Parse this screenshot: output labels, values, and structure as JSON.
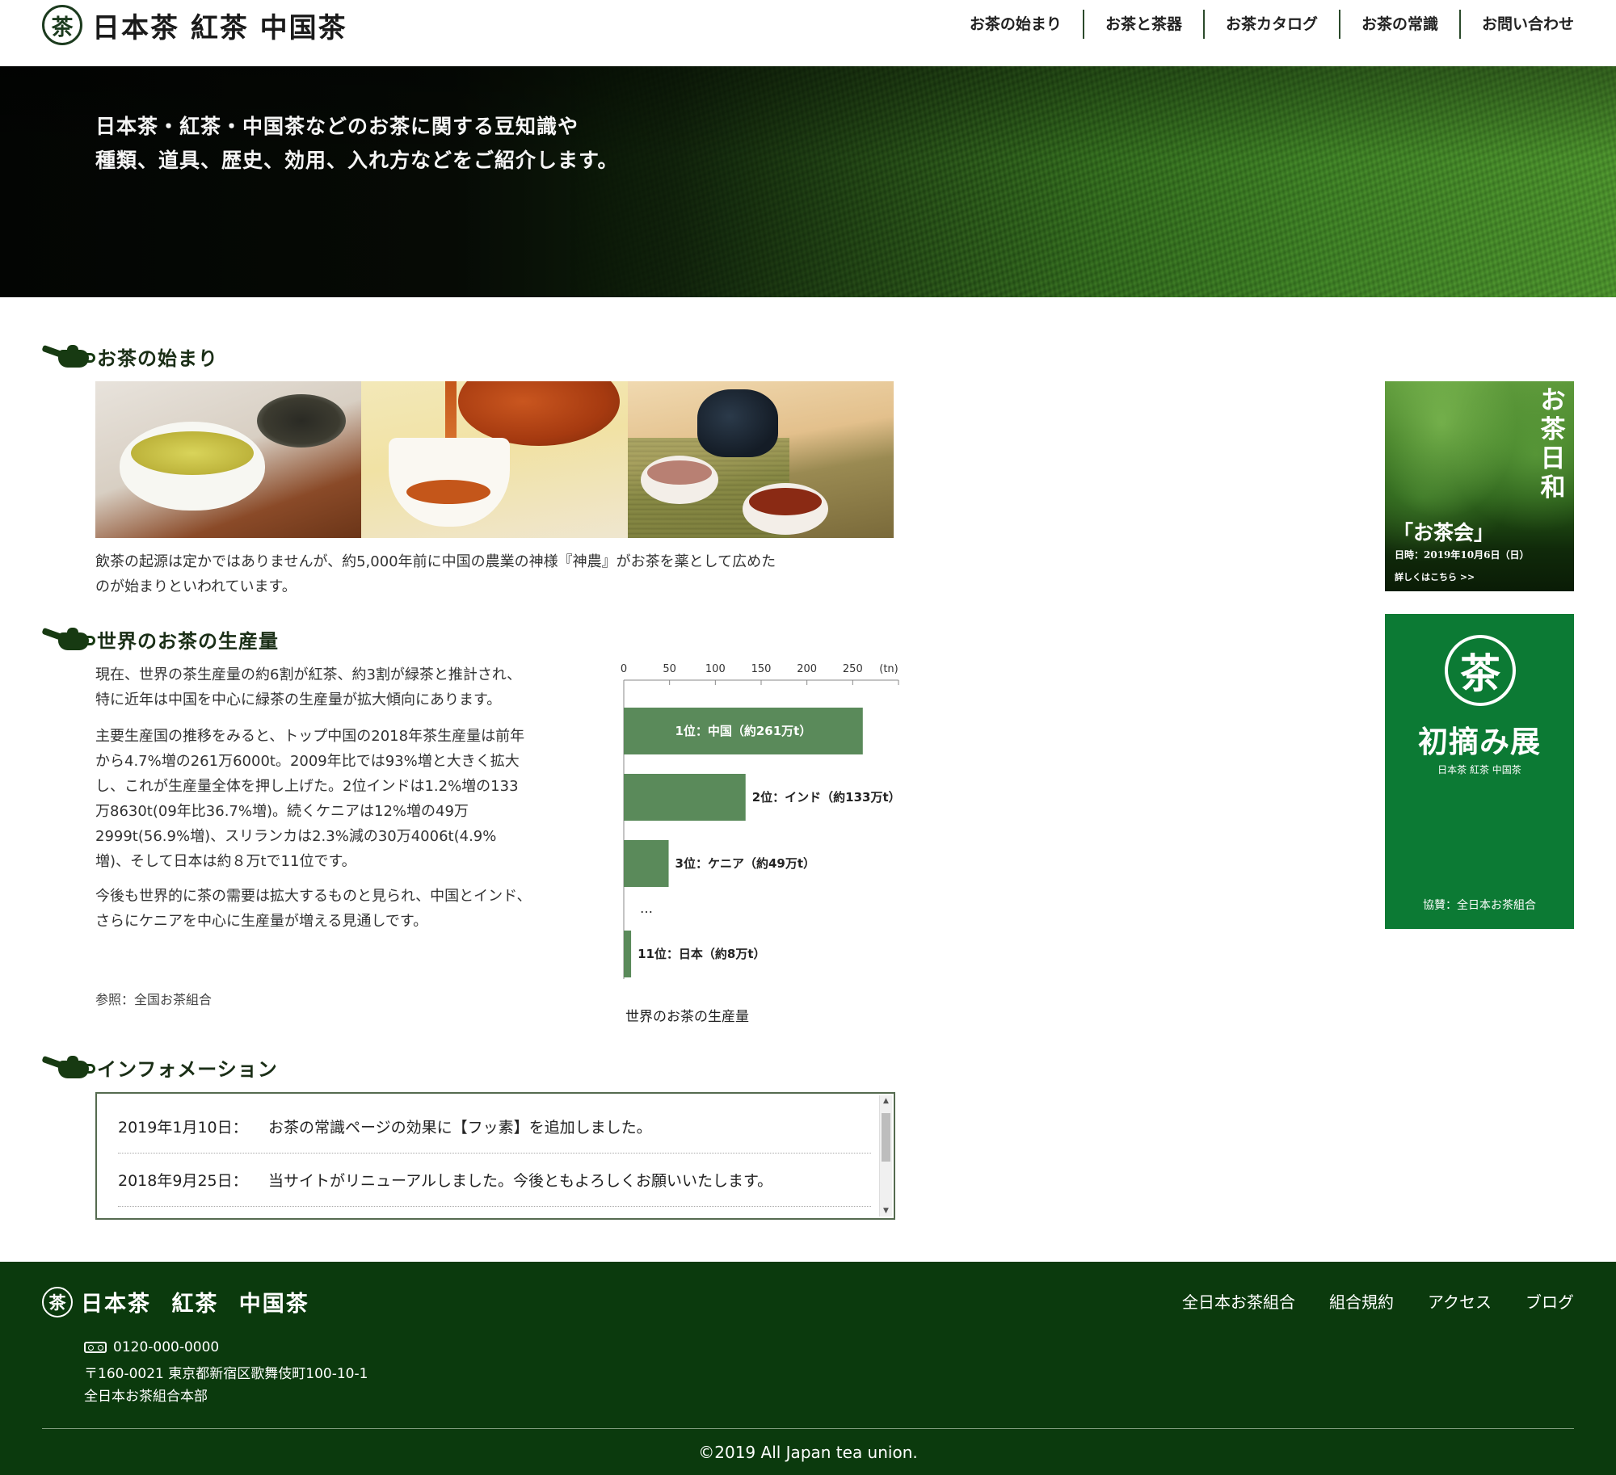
{
  "header": {
    "logo_mark": "茶",
    "logo_text": "日本茶 紅茶 中国茶",
    "nav": [
      "お茶の始まり",
      "お茶と茶器",
      "お茶カタログ",
      "お茶の常識",
      "お問い合わせ"
    ]
  },
  "hero": {
    "line1": "日本茶・紅茶・中国茶などのお茶に関する豆知識や",
    "line2": "種類、道具、歴史、効用、入れ方などをご紹介します。"
  },
  "origin": {
    "title": "お茶の始まり",
    "line1": "飲茶の起源は定かではありませんが、約5,000年前に中国の農業の神様『神農』がお茶を薬として広めた",
    "line2": "のが始まりといわれています。"
  },
  "production": {
    "title": "世界のお茶の生産量",
    "p1_line1": "現在、世界の茶生産量の約6割が紅茶、約3割が緑茶と推計され、",
    "p1_line2": "特に近年は中国を中心に緑茶の生産量が拡大傾向にあります。",
    "p2_line1": "主要生産国の推移をみると、トップ中国の2018年茶生産量は前年",
    "p2_line2": "から4.7%増の261万6000t。2009年比では93%増と大きく拡大",
    "p2_line3": "し、これが生産量全体を押し上げた。2位インドは1.2%増の133",
    "p2_line4": "万8630t(09年比36.7%増)。続くケニアは12%増の49万",
    "p2_line5": "2999t(56.9%増)、スリランカは2.3%減の30万4006t(4.9%",
    "p2_line6": "増)、そして日本は約８万tで11位です。",
    "p3_line1": "今後も世界的に茶の需要は拡大するものと見られ、中国とインド、",
    "p3_line2": "さらにケニアを中心に生産量が増える見通しです。",
    "reference": "参照：全国お茶組合"
  },
  "chart_data": {
    "type": "bar",
    "orientation": "horizontal",
    "title": "",
    "caption": "世界のお茶の生産量",
    "xlabel": "",
    "unit_label": "(tn)",
    "xlim": [
      0,
      300
    ],
    "ticks": [
      "0",
      "50",
      "100",
      "150",
      "200",
      "250"
    ],
    "tick_values": [
      0,
      50,
      100,
      150,
      200,
      250
    ],
    "categories": [
      "1位：中国（約261万t）",
      "2位：インド（約133万t）",
      "3位：ケニア（約49万t）",
      "11位：日本（約8万t）"
    ],
    "values": [
      261,
      133,
      49,
      8
    ],
    "ellipsis": "…",
    "bar_color": "#5a8a5a",
    "label_inside": [
      true,
      false,
      false,
      false
    ],
    "grid": false
  },
  "info": {
    "title": "インフォメーション",
    "items": [
      {
        "date": "2019年1月10日：",
        "text": "お茶の常識ページの効果に【フッ素】を追加しました。"
      },
      {
        "date": "2018年9月25日：",
        "text": "当サイトがリニューアルしました。今後ともよろしくお願いいたします。"
      }
    ]
  },
  "banner1": {
    "vertical_title": "お茶日和",
    "event": "「お茶会」",
    "date": "日時：2019年10月6日（日）",
    "more": "詳しくはこちら >>"
  },
  "banner2": {
    "mark": "茶",
    "title": "初摘み展",
    "subtitle": "日本茶 紅茶 中国茶",
    "sponsor": "協賛：全日本お茶組合"
  },
  "footer": {
    "logo_mark": "茶",
    "logo_text": "日本茶 紅茶 中国茶",
    "nav": [
      "全日本お茶組合",
      "組合規約",
      "アクセス",
      "ブログ"
    ],
    "tel": "0120-000-0000",
    "address": "〒160-0021 東京都新宿区歌舞伎町100-10-1",
    "org": "全日本お茶組合本部",
    "copyright": "©2019 All Japan tea union."
  },
  "colors": {
    "header_green": "#1c3b1e",
    "footer_bg": "#0b3a0d",
    "banner2_bg": "#0c7a34",
    "chart_bar": "#5a8a5a"
  }
}
